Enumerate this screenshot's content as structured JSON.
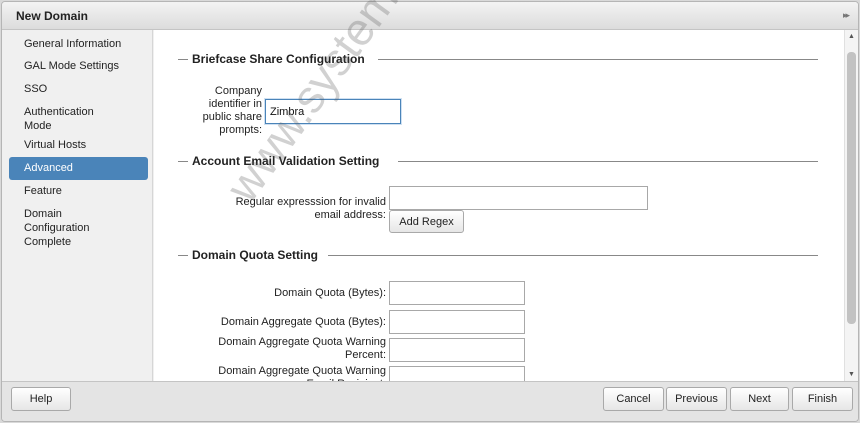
{
  "dialog": {
    "title": "New Domain"
  },
  "sidebar": {
    "items": [
      {
        "label": "General Information"
      },
      {
        "label": "GAL Mode Settings"
      },
      {
        "label": "SSO"
      },
      {
        "label": "Authentication Mode"
      },
      {
        "label": "Virtual Hosts"
      },
      {
        "label": "Advanced",
        "selected": true
      },
      {
        "label": "Feature"
      },
      {
        "label": "Domain Configuration Complete"
      }
    ]
  },
  "briefcase": {
    "title": "Briefcase Share Configuration",
    "company_label": "Company identifier in public share prompts:",
    "company_value": "Zimbra"
  },
  "email_validation": {
    "title": "Account Email Validation Setting",
    "regex_label": "Regular expresssion for invalid email address:",
    "regex_value": "",
    "add_regex_label": "Add Regex"
  },
  "quota": {
    "title": "Domain Quota Setting",
    "domain_quota_label": "Domain Quota (Bytes):",
    "aggregate_quota_label": "Domain Aggregate Quota (Bytes):",
    "warning_percent_label": "Domain Aggregate Quota Warning Percent:",
    "warning_email_label": "Domain Aggregate Quota Warning Email Recipient:"
  },
  "footer": {
    "help_label": "Help",
    "cancel_label": "Cancel",
    "previous_label": "Previous",
    "next_label": "Next",
    "finish_label": "Finish"
  },
  "watermark": {
    "text": "www.systemmen.com"
  },
  "icons": {
    "collapse": "double-chevron-right-icon",
    "scroll_up": "triangle-up-icon",
    "scroll_down": "triangle-down-icon"
  },
  "colors": {
    "selected_nav": "#4a84b9",
    "focus_border": "#4a84b9"
  }
}
